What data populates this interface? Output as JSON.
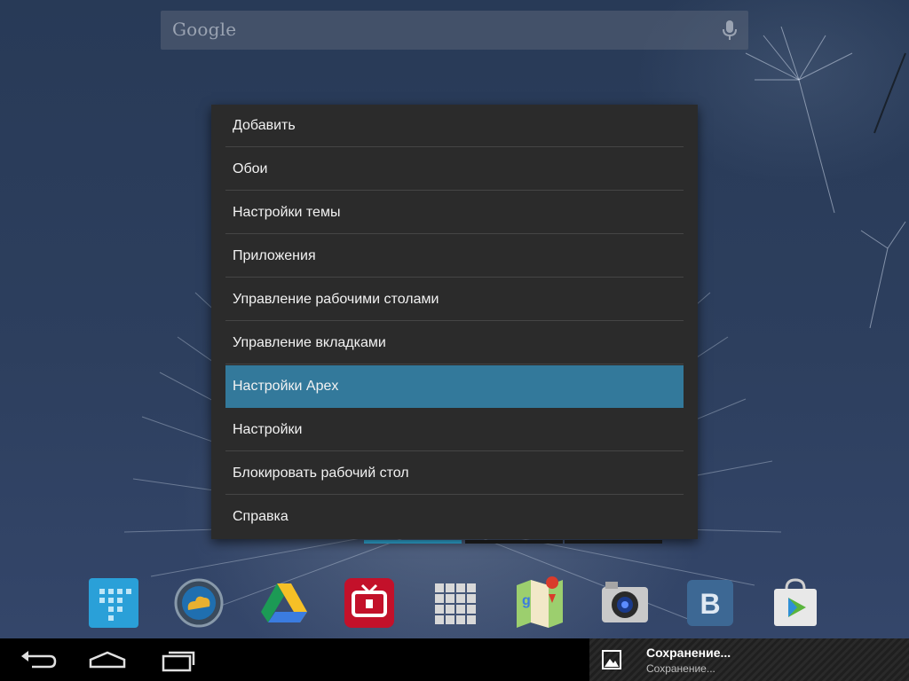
{
  "search": {
    "logo_text": "Google"
  },
  "menu": {
    "items": [
      {
        "label": "Добавить"
      },
      {
        "label": "Обои"
      },
      {
        "label": "Настройки темы"
      },
      {
        "label": "Приложения"
      },
      {
        "label": "Управление рабочими столами"
      },
      {
        "label": "Управление вкладками"
      },
      {
        "label": "Настройки Apex",
        "selected": true
      },
      {
        "label": "Настройки"
      },
      {
        "label": "Блокировать рабочий стол"
      },
      {
        "label": "Справка"
      }
    ],
    "highlight_color": "#33799b"
  },
  "dock": {
    "icons": [
      "calendar-app-icon",
      "weather-app-icon",
      "google-drive-icon",
      "tv-app-icon",
      "app-drawer-icon",
      "google-maps-icon",
      "camera-icon",
      "vk-icon",
      "play-store-icon"
    ],
    "vk_letter": "B"
  },
  "navbar": {
    "buttons": [
      "back-icon",
      "home-icon",
      "recent-apps-icon"
    ]
  },
  "notification": {
    "title": "Сохранение...",
    "subtitle": "Сохранение..."
  }
}
